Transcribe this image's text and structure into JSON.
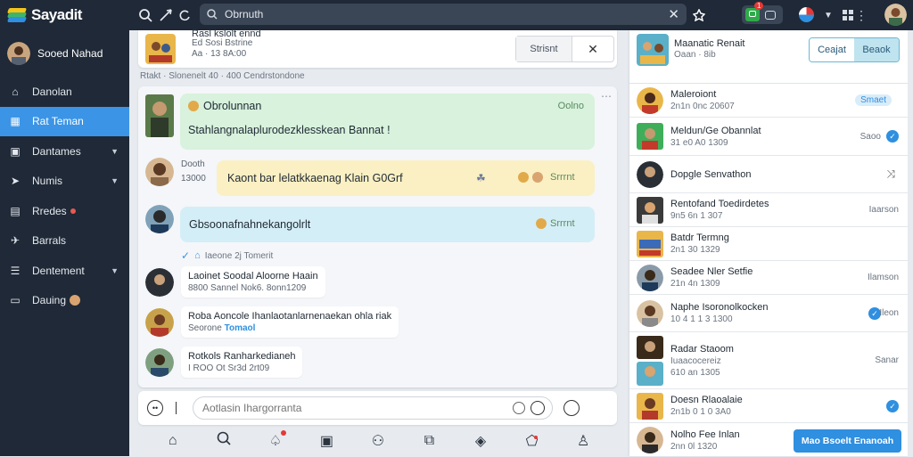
{
  "app": {
    "logo_text": "Sayadit"
  },
  "topbar": {
    "search_value": "Obrnuth",
    "icons": [
      "search-icon",
      "send-icon",
      "refresh-icon",
      "star-icon",
      "message-icon",
      "bell-icon",
      "chevron-down-icon",
      "more-icon"
    ],
    "notif_count": "1"
  },
  "sidebar": {
    "profile_name": "Sooed Nahad",
    "items": [
      {
        "label": "Danolan",
        "icon": "home-icon"
      },
      {
        "label": "Rat Teman",
        "icon": "building-icon"
      },
      {
        "label": "Dantames",
        "icon": "inbox-icon"
      },
      {
        "label": "Numis",
        "icon": "tag-icon"
      },
      {
        "label": "Rredes",
        "icon": "document-icon"
      },
      {
        "label": "Barrals",
        "icon": "bird-icon"
      },
      {
        "label": "Dentement",
        "icon": "list-icon"
      },
      {
        "label": "Dauing",
        "icon": "terminal-icon"
      }
    ]
  },
  "main": {
    "header": {
      "title": "Rasl kslolt ennd",
      "subtitle": "Ed Sosi Bstrine",
      "time": "Aa · 13 8A:00",
      "search_button": "Strisnt"
    },
    "meta_line": "Rtakt · Slonenelt 40 · 400 Cendrstondone",
    "chat": {
      "bubble1_title": "Obrolunnan",
      "bubble1_status": "Oolno",
      "bubble1_text": "Stahlangnalaplurodezklesskean Bannat !",
      "avatar2_name": "Dooth",
      "avatar2_time": "13000",
      "bubble2_text": "Kaont bar lelatkkaenag Klain G0Grf",
      "bubble2_tag": "Srrrnt",
      "bubble3_text": "Gbsoonafnahnekangolrlt",
      "bubble3_tag": "Srrrnt",
      "check_line": "Iaeone 2j Tomerit",
      "messages": [
        {
          "name": "Laoinet Soodal Aloorne Haain",
          "sub": "8800 Sannel Nok6. 8onn1209"
        },
        {
          "name": "Roba Aoncole Ihanlaotanlarnenaekan ohla riak",
          "sub": "Seorone",
          "link": "Tomaol"
        },
        {
          "name": "Rotkols Ranharkedianeh",
          "sub": "I ROO Ot Sr3d 2rt09"
        }
      ]
    },
    "composer_placeholder": "Aotlasin Ihargorranta"
  },
  "right": {
    "header_title": "Maanatic Renait",
    "header_sub": "Oaan · 8ib",
    "btn_cancel": "Ceajat",
    "btn_book": "Beaok",
    "contacts": [
      {
        "name": "Maleroiont",
        "sub": "2n1n 0nc 20607",
        "action": "Smaet"
      },
      {
        "name": "Meldun/Ge Obannlat",
        "sub": "31 e0 A0 1309",
        "action": "Saoo"
      },
      {
        "name": "Dopgle Senvathon",
        "sub": "",
        "action": ""
      },
      {
        "name": "Rentofand Toedirdetes",
        "sub": "9n5 6n 1 307",
        "action": "Iaarson"
      },
      {
        "name": "Batdr Termng",
        "sub": "2n1 30 1329",
        "action": ""
      },
      {
        "name": "Seadee Nler Setfie",
        "sub": "21n 4n 1309",
        "action": "Ilamson"
      },
      {
        "name": "Naphe Isoronolkocken",
        "sub": "10 4 1 1 3 1300",
        "action": "Ileon"
      },
      {
        "name": "Radar Staoom",
        "sub": "Iuaacocereiz",
        "sub2": "610 an 1305",
        "action": "Sanar"
      },
      {
        "name": "Doesn Rlaoalaie",
        "sub": "2n1b 0 1 0 3A0",
        "action": ""
      },
      {
        "name": "Nolho Fee Inlan",
        "sub": "2nn 0l 1320",
        "action": ""
      }
    ],
    "footer_button": "Mao Bsoelt Enanoah"
  },
  "colors": {
    "accent": "#3b94e6",
    "sidebar": "#1f2937",
    "green_bubble": "#d8f2dd",
    "yellow_bubble": "#fbf0c3",
    "blue_bubble": "#d4eef7"
  }
}
